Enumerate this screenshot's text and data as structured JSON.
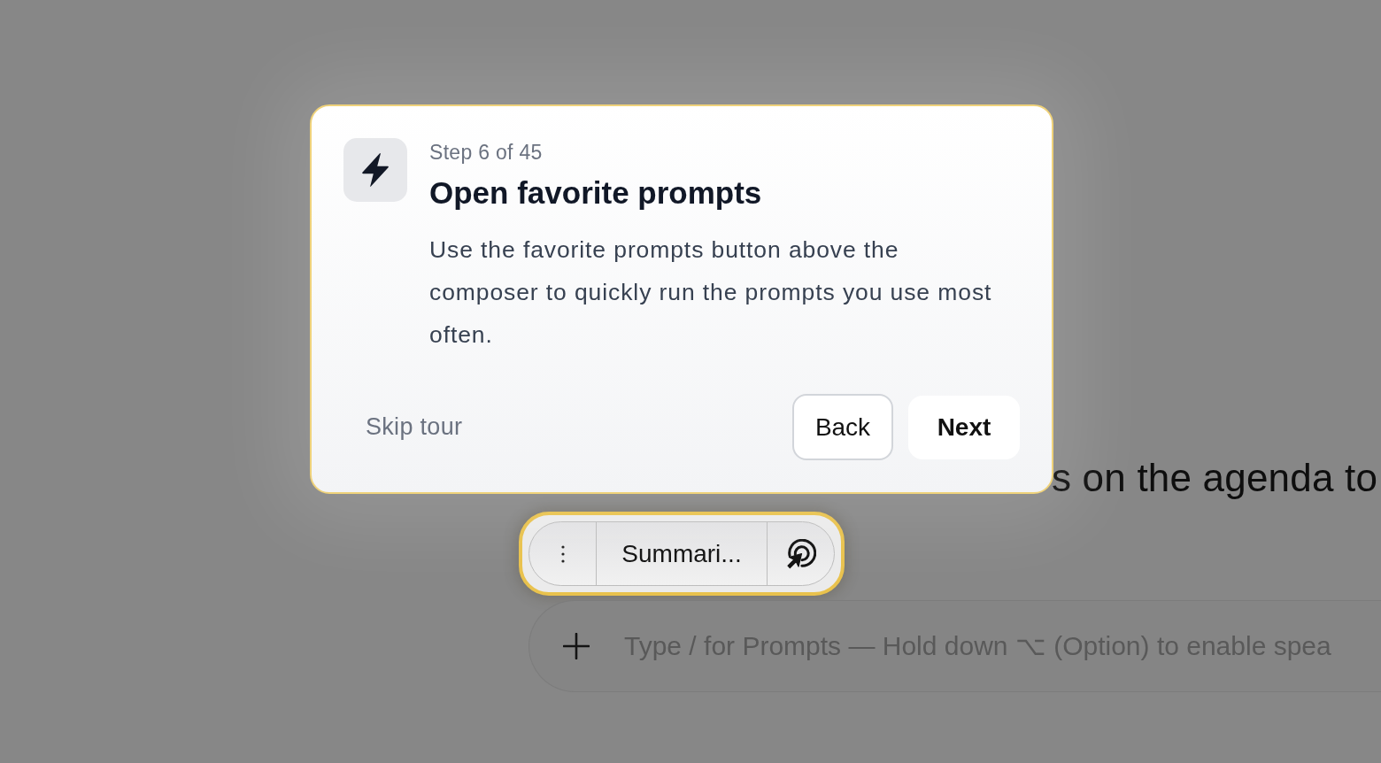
{
  "page": {
    "heading": "s on the agenda to"
  },
  "tour": {
    "step": "Step 6 of 45",
    "title": "Open favorite prompts",
    "body": "Use the favorite prompts button above the composer to quickly run the prompts you use most often.",
    "skip": "Skip tour",
    "buttons": [
      {
        "label": "Back",
        "kind": "secondary"
      },
      {
        "label": "Next",
        "kind": "primary"
      }
    ]
  },
  "favorite_prompts": {
    "highlighted": true,
    "prompt": "Summari..."
  },
  "composer": {
    "placeholder": "Type / for Prompts — Hold down ⌥ (Option) to enable spea"
  }
}
